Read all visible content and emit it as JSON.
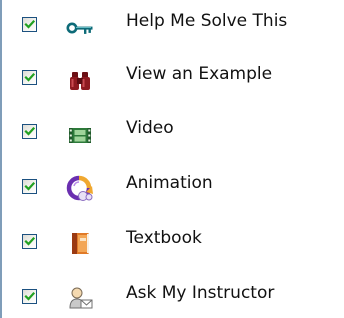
{
  "tools": [
    {
      "label": "Help Me Solve This",
      "checked": true,
      "icon": "key-icon"
    },
    {
      "label": "View an Example",
      "checked": true,
      "icon": "binoculars-icon"
    },
    {
      "label": "Video",
      "checked": true,
      "icon": "film-icon"
    },
    {
      "label": "Animation",
      "checked": true,
      "icon": "animation-icon"
    },
    {
      "label": "Textbook",
      "checked": true,
      "icon": "book-icon"
    },
    {
      "label": "Ask My Instructor",
      "checked": true,
      "icon": "instructor-icon"
    }
  ],
  "colors": {
    "checkmark": "#21a121",
    "checkbox_border": "#1c5180",
    "text": "#111111"
  }
}
